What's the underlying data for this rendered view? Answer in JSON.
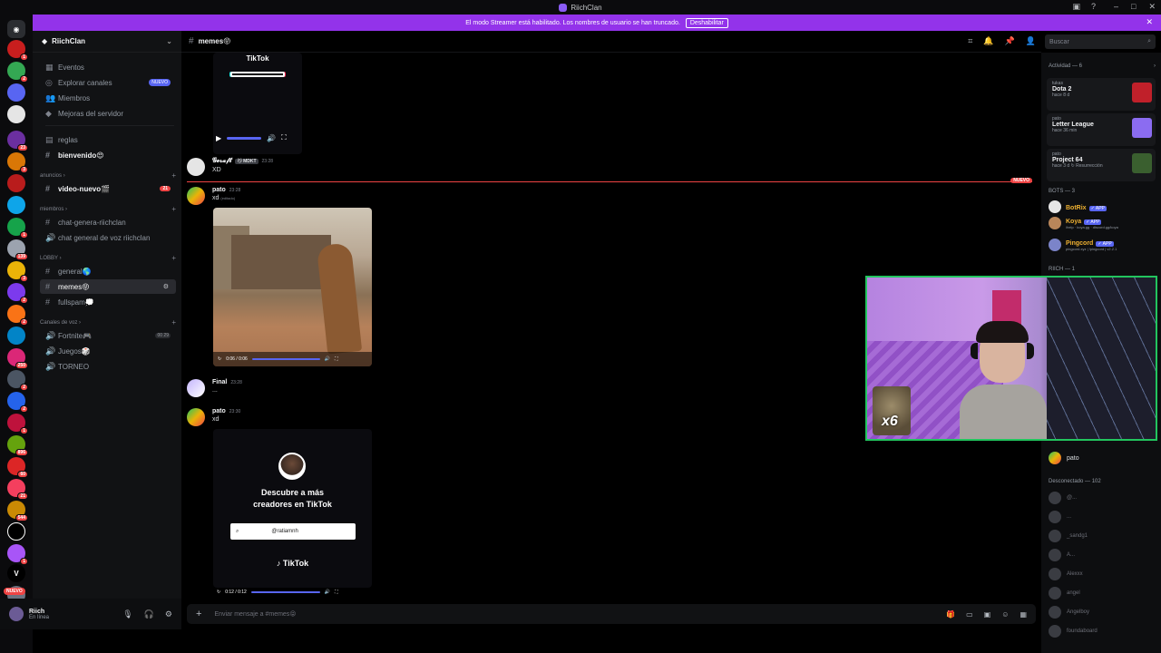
{
  "window": {
    "title": "RiichClan"
  },
  "banner": {
    "text": "El modo Streamer está habilitado. Los nombres de usuario se han truncado.",
    "button": "Deshabilitar"
  },
  "server": {
    "name": "RiichClan"
  },
  "sidebar": {
    "top_items": [
      {
        "label": "Eventos",
        "icon": "calendar-icon"
      },
      {
        "label": "Explorar canales",
        "icon": "compass-icon",
        "tag": "NUEVO"
      },
      {
        "label": "Miembros",
        "icon": "members-icon"
      },
      {
        "label": "Mejoras del servidor",
        "icon": "boost-icon"
      }
    ],
    "channels_a": [
      {
        "label": "reglas"
      },
      {
        "label": "bienvenido😍"
      }
    ],
    "cat_anuncios": "anuncios",
    "video_nuevo": {
      "label": "video-nuevo🎬",
      "count": "21"
    },
    "cat_miembros": "miembros",
    "chat_genera": "chat-genera-riichclan",
    "chat_voz": "chat general de voz riichclan",
    "cat_lobby": "LOBBY",
    "lobby": [
      {
        "label": "general🌎"
      },
      {
        "label": "memes😝"
      },
      {
        "label": "fullspam💭"
      }
    ],
    "cat_voz": "Canales de voz",
    "voice": [
      {
        "label": "Fortnite🎮",
        "meta": "00 29"
      },
      {
        "label": "Juegos🎲"
      },
      {
        "label": "TORNEO"
      }
    ]
  },
  "user": {
    "name": "Riich",
    "status": "En línea"
  },
  "channel": {
    "name": "memes😝"
  },
  "search": {
    "placeholder": "Buscar"
  },
  "messages": {
    "tiktok_top": "TikTok",
    "geraf": {
      "author": "𝓖𝓮𝓻𝓪𝓯𝓽",
      "tag": "😼 MDKT",
      "time": "23:28",
      "text": "XD"
    },
    "new_label": "NUEVO",
    "pato1": {
      "author": "pato",
      "time": "23:28",
      "text": "xd",
      "edited": "(editado)",
      "video_time": "0:06 / 0:06"
    },
    "final": {
      "author": "Final",
      "time": "23:28",
      "text": "..."
    },
    "pato2": {
      "author": "pato",
      "time": "23:30",
      "text": "xd"
    },
    "tiktok_card": {
      "line1": "Descubre a más",
      "line2": "creadores en TikTok",
      "search_value": "@ratiamnh",
      "logo": "TikTok",
      "video_time": "0:12 / 0:12"
    }
  },
  "composer": {
    "placeholder": "Enviar mensaje a #memes😝"
  },
  "members": {
    "activity_header": "Actividad — 6",
    "activities": [
      {
        "who": "tukas",
        "game": "Dota 2",
        "since": "hace 8 d",
        "color": "#c0202a"
      },
      {
        "who": "pato",
        "game": "Letter League",
        "since": "hace 36 min",
        "color": "#8b6cf1"
      },
      {
        "who": "pato",
        "game": "Project 64",
        "since": "hace 3 d  ↻ Resurrección",
        "color": "#3a5f2f"
      }
    ],
    "bots_header": "BOTS — 3",
    "bots": [
      {
        "name": "BotRix",
        "app": "✓ APP",
        "sub": "",
        "color": "#e6e6e6"
      },
      {
        "name": "Koya",
        "app": "✓ APP",
        "sub": "/help · koya.gg · discord.gg/koya",
        "color": "#b9865a"
      },
      {
        "name": "Pingcord",
        "app": "✓ APP",
        "sub": "pingcord.xyz | !pingcord | v2.2.1",
        "color": "#7b84c9"
      }
    ],
    "riich_header": "RIICH — 1",
    "online_member": "pato",
    "offline_header": "Desconectado — 102",
    "offline": [
      "@...",
      "...",
      "_sandg1",
      "A...",
      "Alexxx",
      "angel",
      "Angelboy",
      "foundaboard"
    ]
  },
  "overlay": {
    "multiplier": "x6"
  }
}
